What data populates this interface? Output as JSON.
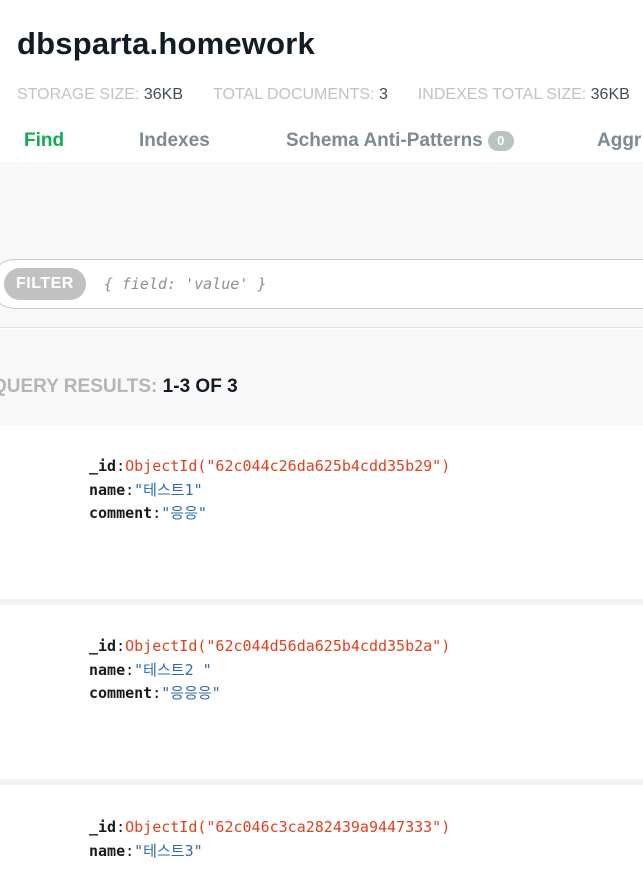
{
  "namespace": {
    "title": "dbsparta.homework"
  },
  "stats": [
    {
      "label": "STORAGE SIZE:",
      "value": "36KB"
    },
    {
      "label": "TOTAL DOCUMENTS:",
      "value": "3"
    },
    {
      "label": "INDEXES TOTAL SIZE:",
      "value": "36KB"
    }
  ],
  "tabs": [
    {
      "label": "Find",
      "active": true
    },
    {
      "label": "Indexes"
    },
    {
      "label": "Schema Anti-Patterns",
      "badge": "0"
    },
    {
      "label": "Aggr"
    }
  ],
  "filter": {
    "label": "FILTER",
    "placeholder": "{ field: 'value' }"
  },
  "results": {
    "label": "QUERY RESULTS:",
    "value": "1-3 OF 3"
  },
  "documents": [
    {
      "id_key": "_id",
      "id_value": "ObjectId(\"62c044c26da625b4cdd35b29\")",
      "name_key": "name",
      "name_value": "\"테스트1\"",
      "comment_key": "comment",
      "comment_value": "\"응응\""
    },
    {
      "id_key": "_id",
      "id_value": "ObjectId(\"62c044d56da625b4cdd35b2a\")",
      "name_key": "name",
      "name_value": "\"테스트2 \"",
      "comment_key": "comment",
      "comment_value": "\"응응응\""
    },
    {
      "id_key": "_id",
      "id_value": "ObjectId(\"62c046c3ca282439a9447333\")",
      "name_key": "name",
      "name_value": "\"테스트3\""
    }
  ],
  "colors": {
    "active_tab": "#13aa52",
    "object_id": "#e0401f",
    "string_value": "#2d6cae"
  }
}
